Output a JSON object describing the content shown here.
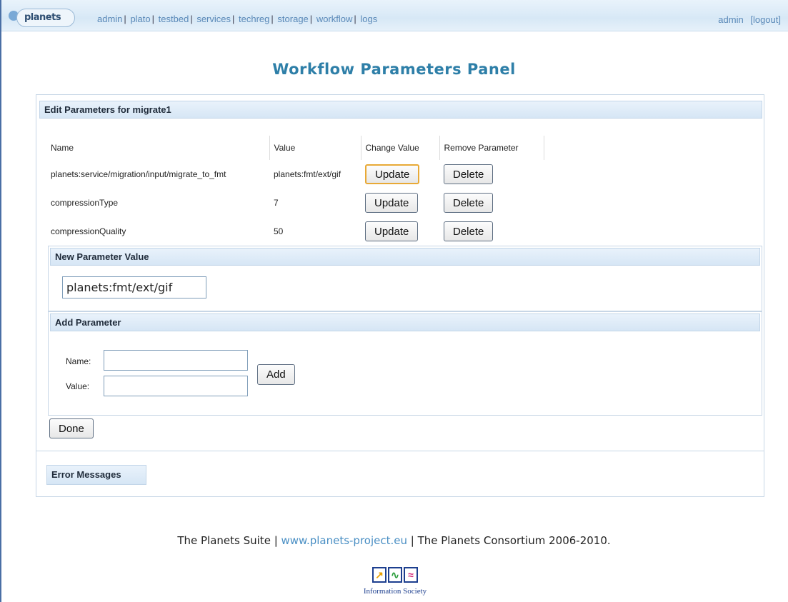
{
  "header": {
    "logo_text": "planets",
    "nav": [
      "admin",
      "plato",
      "testbed",
      "services",
      "techreg",
      "storage",
      "workflow",
      "logs"
    ],
    "user": "admin",
    "logout": "[logout]"
  },
  "page": {
    "title": "Workflow Parameters Panel"
  },
  "edit": {
    "heading": "Edit Parameters for migrate1",
    "columns": {
      "name": "Name",
      "value": "Value",
      "change": "Change Value",
      "remove": "Remove Parameter"
    },
    "rows": [
      {
        "name": "planets:service/migration/input/migrate_to_fmt",
        "value": "planets:fmt/ext/gif",
        "update": "Update",
        "delete": "Delete"
      },
      {
        "name": "compressionType",
        "value": "7",
        "update": "Update",
        "delete": "Delete"
      },
      {
        "name": "compressionQuality",
        "value": "50",
        "update": "Update",
        "delete": "Delete"
      }
    ]
  },
  "new_value": {
    "heading": "New Parameter Value",
    "value": "planets:fmt/ext/gif"
  },
  "add": {
    "heading": "Add Parameter",
    "name_label": "Name:",
    "value_label": "Value:",
    "add_label": "Add"
  },
  "done_label": "Done",
  "errors": {
    "heading": "Error Messages"
  },
  "footer": {
    "prefix": "The Planets Suite | ",
    "link": "www.planets-project.eu",
    "suffix": " | The Planets Consortium 2006-2010.",
    "caption": "Information Society"
  }
}
